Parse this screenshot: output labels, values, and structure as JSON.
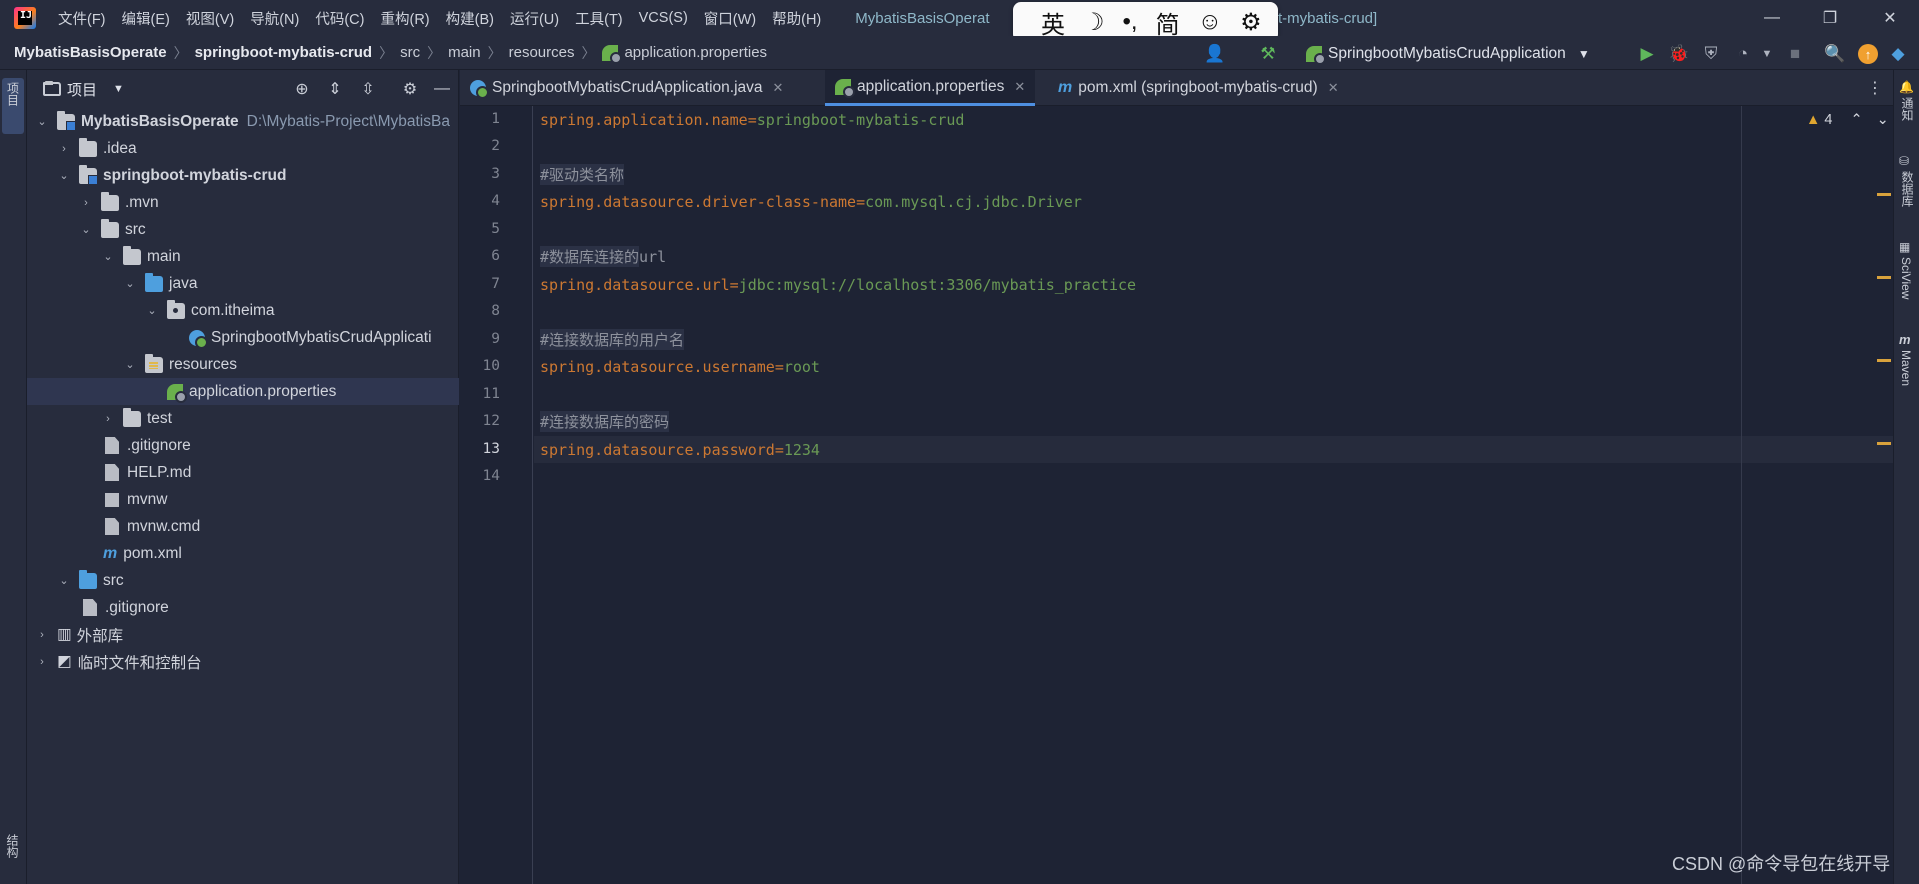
{
  "titlebar": {
    "menus": [
      "文件(F)",
      "编辑(E)",
      "视图(V)",
      "导航(N)",
      "代码(C)",
      "重构(R)",
      "构建(B)",
      "运行(U)",
      "工具(T)",
      "VCS(S)",
      "窗口(W)",
      "帮助(H)"
    ],
    "window_title_left": "MybatisBasisOperat",
    "window_title_right": "t-mybatis-crud]"
  },
  "ime": {
    "lang": "英",
    "moon": "☽",
    "punct": "•,",
    "simplified": "简",
    "emoji": "☺",
    "settings": "⚙"
  },
  "breadcrumb": [
    "MybatisBasisOperate",
    "springboot-mybatis-crud",
    "src",
    "main",
    "resources",
    "application.properties"
  ],
  "run_config": "SpringbootMybatisCrudApplication",
  "project_panel": {
    "title": "项目",
    "tree": [
      {
        "label": "MybatisBasisOperate",
        "path": "D:\\Mybatis-Project\\MybatisBa",
        "bold": true
      },
      {
        "label": ".idea"
      },
      {
        "label": "springboot-mybatis-crud",
        "bold": true
      },
      {
        "label": ".mvn"
      },
      {
        "label": "src"
      },
      {
        "label": "main"
      },
      {
        "label": "java"
      },
      {
        "label": "com.itheima"
      },
      {
        "label": "SpringbootMybatisCrudApplicati"
      },
      {
        "label": "resources"
      },
      {
        "label": "application.properties"
      },
      {
        "label": "test"
      },
      {
        "label": ".gitignore"
      },
      {
        "label": "HELP.md"
      },
      {
        "label": "mvnw"
      },
      {
        "label": "mvnw.cmd"
      },
      {
        "label": "pom.xml"
      },
      {
        "label": "src"
      },
      {
        "label": ".gitignore"
      },
      {
        "label": "外部库"
      },
      {
        "label": "临时文件和控制台"
      }
    ]
  },
  "tabs": [
    {
      "label": "SpringbootMybatisCrudApplication.java",
      "close": "✕"
    },
    {
      "label": "application.properties",
      "close": "✕"
    },
    {
      "label": "pom.xml (springboot-mybatis-crud)",
      "close": "✕"
    }
  ],
  "editor": {
    "line_numbers": [
      "1",
      "2",
      "3",
      "4",
      "5",
      "6",
      "7",
      "8",
      "9",
      "10",
      "11",
      "12",
      "13",
      "14"
    ],
    "lines": [
      {
        "key": "spring.application.name",
        "eq": "=",
        "value": "springboot-mybatis-crud"
      },
      {},
      {
        "comment_hl": "#驱动类名称",
        "comment_rest": ""
      },
      {
        "key": "spring.datasource.driver-class-name",
        "eq": "=",
        "value": "com.mysql.cj.jdbc.Driver"
      },
      {},
      {
        "comment_hl": "#数据库连接的",
        "comment_rest": "url"
      },
      {
        "key": "spring.datasource.url",
        "eq": "=",
        "value": "jdbc:mysql://localhost:3306/mybatis_practice"
      },
      {},
      {
        "comment_hl": "#连接数据库的用户名",
        "comment_rest": ""
      },
      {
        "key": "spring.datasource.username",
        "eq": "=",
        "value": "root"
      },
      {},
      {
        "comment_hl": "#连接数据库的密码",
        "comment_rest": ""
      },
      {
        "key": "spring.datasource.password",
        "eq": "=",
        "value": "1234"
      },
      {}
    ],
    "warning_count": "4"
  },
  "right_tools": [
    "通知",
    "数据库",
    "SciView",
    "Maven"
  ],
  "left_tools": [
    "项目",
    "结构"
  ],
  "watermark": "CSDN @命令导包在线开导"
}
